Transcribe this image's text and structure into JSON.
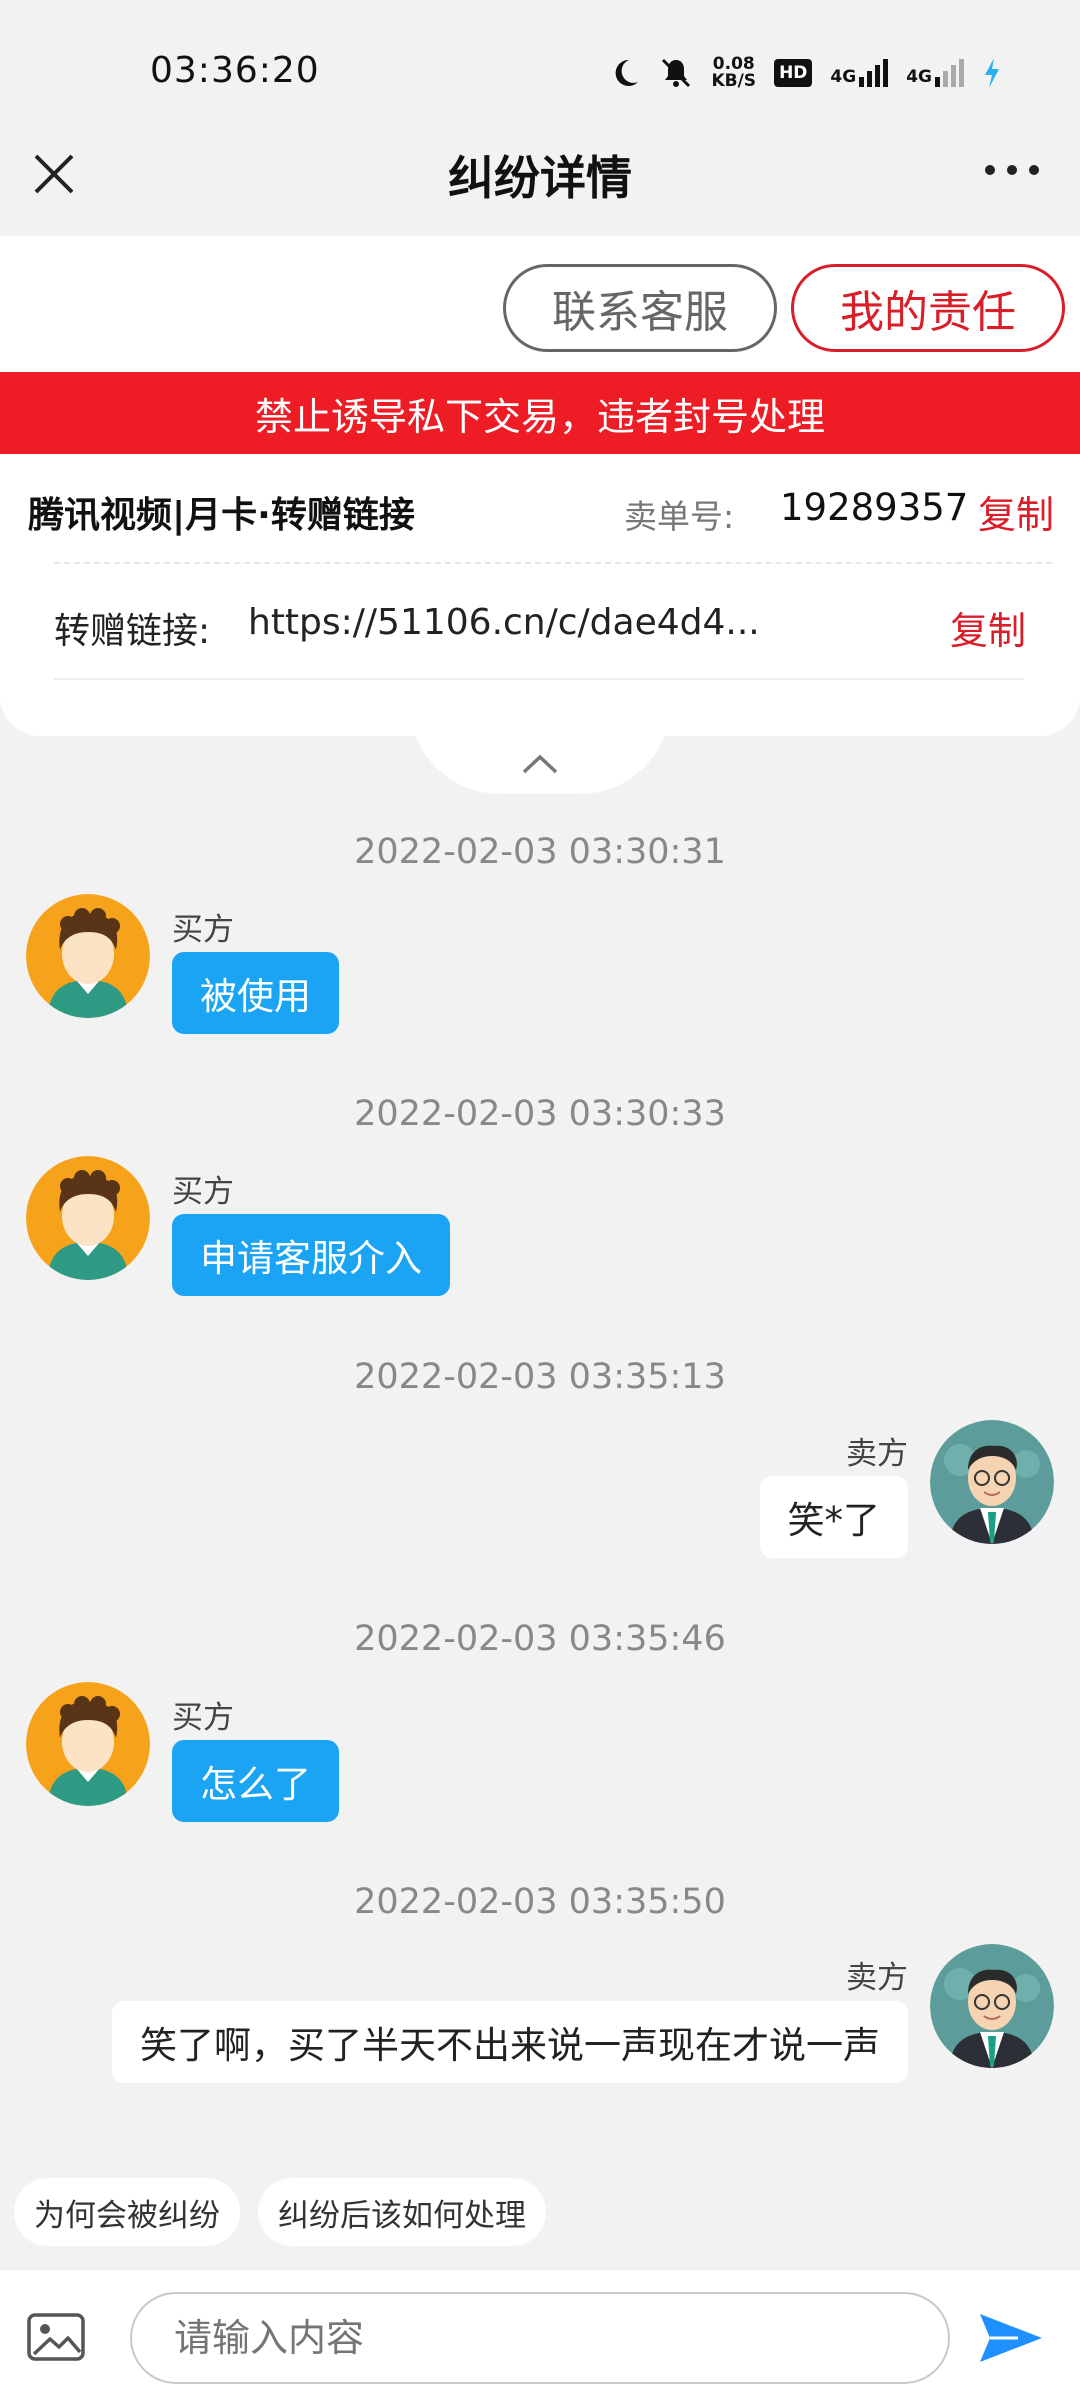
{
  "status_bar": {
    "time": "03:36:20",
    "net_speed_value": "0.08",
    "net_speed_unit": "KB/S",
    "hd_label": "HD",
    "sim1_label": "4G",
    "sim2_label": "4G"
  },
  "nav": {
    "title": "纠纷详情"
  },
  "actions": {
    "contact_service": "联系客服",
    "my_responsibility": "我的责任"
  },
  "warning_banner": "禁止诱导私下交易，违者封号处理",
  "order": {
    "product_name": "腾讯视频|月卡·转赠链接",
    "order_label": "卖单号:",
    "order_number": "19289357",
    "copy_label": "复制",
    "link_label": "转赠链接:",
    "link_value": "https://51106.cn/c/dae4d4...",
    "link_copy_label": "复制"
  },
  "messages": [
    {
      "time": "2022-02-03 03:30:31",
      "sender": "买方",
      "text": "被使用",
      "side": "left"
    },
    {
      "time": "2022-02-03 03:30:33",
      "sender": "买方",
      "text": "申请客服介入",
      "side": "left"
    },
    {
      "time": "2022-02-03 03:35:13",
      "sender": "卖方",
      "text": "笑*了",
      "side": "right"
    },
    {
      "time": "2022-02-03 03:35:46",
      "sender": "买方",
      "text": "怎么了",
      "side": "left"
    },
    {
      "time": "2022-02-03 03:35:50",
      "sender": "卖方",
      "text": "笑了啊，买了半天不出来说一声现在才说一声",
      "side": "right"
    }
  ],
  "quick_tags": [
    "为何会被纠纷",
    "纠纷后该如何处理"
  ],
  "input": {
    "placeholder": "请输入内容"
  },
  "colors": {
    "accent_red": "#d81e28",
    "banner_red": "#ee1c24",
    "bubble_blue": "#1ca4f4",
    "send_blue": "#1e90ff",
    "background": "#f2f2f2"
  }
}
